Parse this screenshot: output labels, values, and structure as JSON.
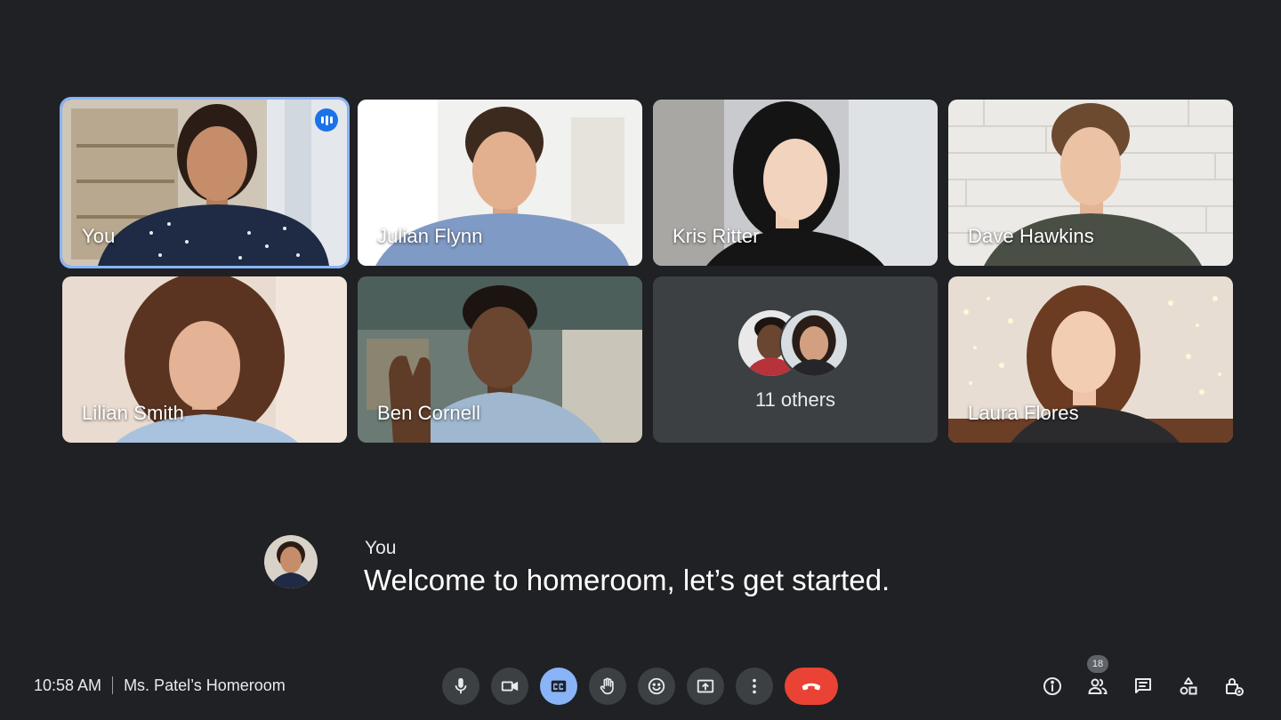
{
  "participants": [
    {
      "name": "You"
    },
    {
      "name": "Julian Flynn"
    },
    {
      "name": "Kris Ritter"
    },
    {
      "name": "Dave Hawkins"
    },
    {
      "name": "Lilian Smith"
    },
    {
      "name": "Ben Cornell"
    },
    {
      "name": "Laura Flores"
    }
  ],
  "others": {
    "label": "11  others"
  },
  "caption": {
    "speaker": "You",
    "text": "Welcome to homeroom, let’s get started."
  },
  "meeting": {
    "time": "10:58 AM",
    "title": "Ms. Patel’s Homeroom"
  },
  "controls": {
    "icons": [
      "microphone-icon",
      "camera-icon",
      "closed-captions-icon",
      "raise-hand-icon",
      "emoji-icon",
      "present-icon",
      "more-options-icon",
      "end-call-icon"
    ]
  },
  "side_controls": {
    "people_count": "18",
    "icons": [
      "info-icon",
      "people-icon",
      "chat-icon",
      "activities-icon",
      "host-controls-icon"
    ]
  },
  "colors": {
    "background": "#202124",
    "tile_surface": "#3c4043",
    "accent": "#8ab4f8",
    "speaking": "#1a73e8",
    "end_call": "#ea4335"
  }
}
